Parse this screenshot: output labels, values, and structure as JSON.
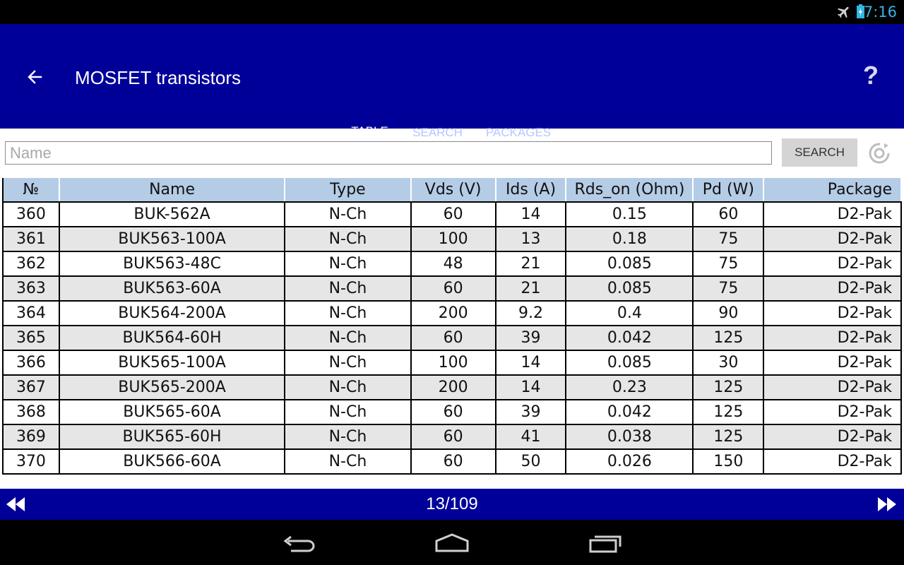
{
  "status": {
    "time": "7:16"
  },
  "app": {
    "title": "MOSFET transistors",
    "help": "?"
  },
  "tabs": [
    {
      "label": "TABLE",
      "active": true
    },
    {
      "label": "SEARCH",
      "active": false
    },
    {
      "label": "PACKAGES",
      "active": false
    }
  ],
  "search": {
    "placeholder": "Name",
    "value": "",
    "button_label": "SEARCH"
  },
  "table": {
    "columns": [
      "№",
      "Name",
      "Type",
      "Vds (V)",
      "Ids (A)",
      "Rds_on (Ohm)",
      "Pd (W)",
      "Package"
    ],
    "rows": [
      [
        "360",
        "BUK-562A",
        "N-Ch",
        "60",
        "14",
        "0.15",
        "60",
        "D2-Pak"
      ],
      [
        "361",
        "BUK563-100A",
        "N-Ch",
        "100",
        "13",
        "0.18",
        "75",
        "D2-Pak"
      ],
      [
        "362",
        "BUK563-48C",
        "N-Ch",
        "48",
        "21",
        "0.085",
        "75",
        "D2-Pak"
      ],
      [
        "363",
        "BUK563-60A",
        "N-Ch",
        "60",
        "21",
        "0.085",
        "75",
        "D2-Pak"
      ],
      [
        "364",
        "BUK564-200A",
        "N-Ch",
        "200",
        "9.2",
        "0.4",
        "90",
        "D2-Pak"
      ],
      [
        "365",
        "BUK564-60H",
        "N-Ch",
        "60",
        "39",
        "0.042",
        "125",
        "D2-Pak"
      ],
      [
        "366",
        "BUK565-100A",
        "N-Ch",
        "100",
        "14",
        "0.085",
        "30",
        "D2-Pak"
      ],
      [
        "367",
        "BUK565-200A",
        "N-Ch",
        "200",
        "14",
        "0.23",
        "125",
        "D2-Pak"
      ],
      [
        "368",
        "BUK565-60A",
        "N-Ch",
        "60",
        "39",
        "0.042",
        "125",
        "D2-Pak"
      ],
      [
        "369",
        "BUK565-60H",
        "N-Ch",
        "60",
        "41",
        "0.038",
        "125",
        "D2-Pak"
      ],
      [
        "370",
        "BUK566-60A",
        "N-Ch",
        "60",
        "50",
        "0.026",
        "150",
        "D2-Pak"
      ]
    ]
  },
  "pager": {
    "page_info": "13/109"
  },
  "colors": {
    "app_bar": "#000099",
    "tab_indicator": "#33b5e5",
    "header_row": "#b5cce6",
    "alt_row": "#e6e6e6"
  }
}
